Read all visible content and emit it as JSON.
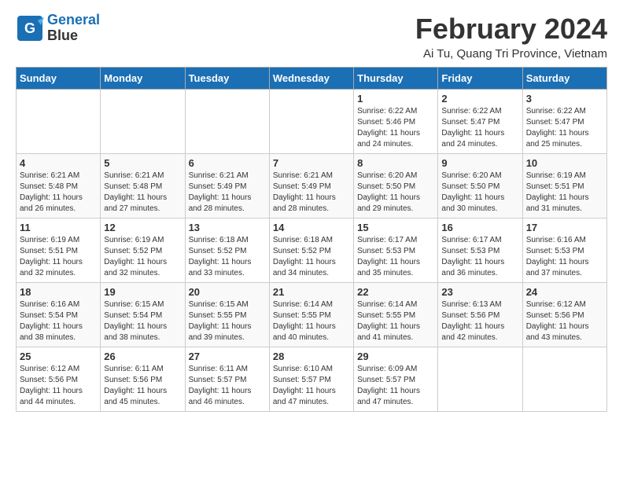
{
  "header": {
    "logo_line1": "General",
    "logo_line2": "Blue",
    "month": "February 2024",
    "location": "Ai Tu, Quang Tri Province, Vietnam"
  },
  "weekdays": [
    "Sunday",
    "Monday",
    "Tuesday",
    "Wednesday",
    "Thursday",
    "Friday",
    "Saturday"
  ],
  "weeks": [
    [
      {
        "day": "",
        "info": ""
      },
      {
        "day": "",
        "info": ""
      },
      {
        "day": "",
        "info": ""
      },
      {
        "day": "",
        "info": ""
      },
      {
        "day": "1",
        "info": "Sunrise: 6:22 AM\nSunset: 5:46 PM\nDaylight: 11 hours\nand 24 minutes."
      },
      {
        "day": "2",
        "info": "Sunrise: 6:22 AM\nSunset: 5:47 PM\nDaylight: 11 hours\nand 24 minutes."
      },
      {
        "day": "3",
        "info": "Sunrise: 6:22 AM\nSunset: 5:47 PM\nDaylight: 11 hours\nand 25 minutes."
      }
    ],
    [
      {
        "day": "4",
        "info": "Sunrise: 6:21 AM\nSunset: 5:48 PM\nDaylight: 11 hours\nand 26 minutes."
      },
      {
        "day": "5",
        "info": "Sunrise: 6:21 AM\nSunset: 5:48 PM\nDaylight: 11 hours\nand 27 minutes."
      },
      {
        "day": "6",
        "info": "Sunrise: 6:21 AM\nSunset: 5:49 PM\nDaylight: 11 hours\nand 28 minutes."
      },
      {
        "day": "7",
        "info": "Sunrise: 6:21 AM\nSunset: 5:49 PM\nDaylight: 11 hours\nand 28 minutes."
      },
      {
        "day": "8",
        "info": "Sunrise: 6:20 AM\nSunset: 5:50 PM\nDaylight: 11 hours\nand 29 minutes."
      },
      {
        "day": "9",
        "info": "Sunrise: 6:20 AM\nSunset: 5:50 PM\nDaylight: 11 hours\nand 30 minutes."
      },
      {
        "day": "10",
        "info": "Sunrise: 6:19 AM\nSunset: 5:51 PM\nDaylight: 11 hours\nand 31 minutes."
      }
    ],
    [
      {
        "day": "11",
        "info": "Sunrise: 6:19 AM\nSunset: 5:51 PM\nDaylight: 11 hours\nand 32 minutes."
      },
      {
        "day": "12",
        "info": "Sunrise: 6:19 AM\nSunset: 5:52 PM\nDaylight: 11 hours\nand 32 minutes."
      },
      {
        "day": "13",
        "info": "Sunrise: 6:18 AM\nSunset: 5:52 PM\nDaylight: 11 hours\nand 33 minutes."
      },
      {
        "day": "14",
        "info": "Sunrise: 6:18 AM\nSunset: 5:52 PM\nDaylight: 11 hours\nand 34 minutes."
      },
      {
        "day": "15",
        "info": "Sunrise: 6:17 AM\nSunset: 5:53 PM\nDaylight: 11 hours\nand 35 minutes."
      },
      {
        "day": "16",
        "info": "Sunrise: 6:17 AM\nSunset: 5:53 PM\nDaylight: 11 hours\nand 36 minutes."
      },
      {
        "day": "17",
        "info": "Sunrise: 6:16 AM\nSunset: 5:53 PM\nDaylight: 11 hours\nand 37 minutes."
      }
    ],
    [
      {
        "day": "18",
        "info": "Sunrise: 6:16 AM\nSunset: 5:54 PM\nDaylight: 11 hours\nand 38 minutes."
      },
      {
        "day": "19",
        "info": "Sunrise: 6:15 AM\nSunset: 5:54 PM\nDaylight: 11 hours\nand 38 minutes."
      },
      {
        "day": "20",
        "info": "Sunrise: 6:15 AM\nSunset: 5:55 PM\nDaylight: 11 hours\nand 39 minutes."
      },
      {
        "day": "21",
        "info": "Sunrise: 6:14 AM\nSunset: 5:55 PM\nDaylight: 11 hours\nand 40 minutes."
      },
      {
        "day": "22",
        "info": "Sunrise: 6:14 AM\nSunset: 5:55 PM\nDaylight: 11 hours\nand 41 minutes."
      },
      {
        "day": "23",
        "info": "Sunrise: 6:13 AM\nSunset: 5:56 PM\nDaylight: 11 hours\nand 42 minutes."
      },
      {
        "day": "24",
        "info": "Sunrise: 6:12 AM\nSunset: 5:56 PM\nDaylight: 11 hours\nand 43 minutes."
      }
    ],
    [
      {
        "day": "25",
        "info": "Sunrise: 6:12 AM\nSunset: 5:56 PM\nDaylight: 11 hours\nand 44 minutes."
      },
      {
        "day": "26",
        "info": "Sunrise: 6:11 AM\nSunset: 5:56 PM\nDaylight: 11 hours\nand 45 minutes."
      },
      {
        "day": "27",
        "info": "Sunrise: 6:11 AM\nSunset: 5:57 PM\nDaylight: 11 hours\nand 46 minutes."
      },
      {
        "day": "28",
        "info": "Sunrise: 6:10 AM\nSunset: 5:57 PM\nDaylight: 11 hours\nand 47 minutes."
      },
      {
        "day": "29",
        "info": "Sunrise: 6:09 AM\nSunset: 5:57 PM\nDaylight: 11 hours\nand 47 minutes."
      },
      {
        "day": "",
        "info": ""
      },
      {
        "day": "",
        "info": ""
      }
    ]
  ]
}
